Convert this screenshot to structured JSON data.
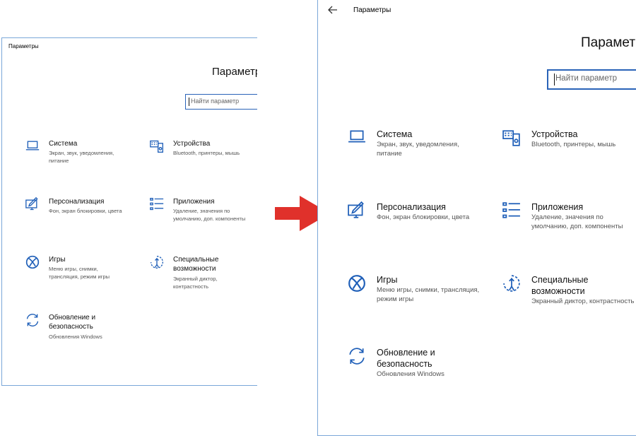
{
  "window_title": "Параметры",
  "heading": "Параметры",
  "search_placeholder": "Найти параметр",
  "items": [
    {
      "name": "Система",
      "desc": "Экран, звук, уведомления, питание",
      "icon": "laptop-icon"
    },
    {
      "name": "Устройства",
      "desc": "Bluetooth, принтеры, мышь",
      "icon": "devices-icon"
    },
    {
      "name": "Персонализация",
      "desc": "Фон, экран блокировки, цвета",
      "icon": "personalization-icon"
    },
    {
      "name": "Приложения",
      "desc": "Удаление, значения по умолчанию, доп. компоненты",
      "icon": "apps-list-icon"
    },
    {
      "name": "Игры",
      "desc": "Меню игры, снимки, трансляция, режим игры",
      "icon": "xbox-icon"
    },
    {
      "name": "Специальные возможности",
      "desc": "Экранный диктор, контрастность",
      "icon": "ease-of-access-icon"
    },
    {
      "name": "Обновление и безопасность",
      "desc": "Обновления Windows",
      "icon": "update-sync-icon"
    }
  ],
  "colors": {
    "accent": "#1f5fb8",
    "arrow": "#e0312b",
    "border": "#7aa7d8"
  }
}
